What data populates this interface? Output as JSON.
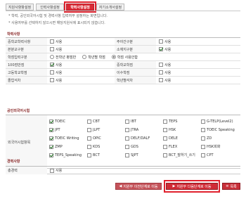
{
  "tabs": [
    {
      "label": "지원사항항설정",
      "active": false
    },
    {
      "label": "인력사항설정",
      "active": false
    },
    {
      "label": "학력사항설정",
      "active": true
    },
    {
      "label": "자기소개서설정",
      "active": false
    }
  ],
  "notices": [
    "* 학력, 공인외국어시험 및 경력사항 입력여부 설정하는 화면입니다.",
    "* 사용여부를 선택하지 않으시면 해당지원서에 표시되지 않습니다."
  ],
  "sections": {
    "education": "학력사항",
    "language": "공인외국어시험",
    "career": "경력사항"
  },
  "common_option": "사용",
  "education_rows": [
    {
      "left_label": "중학교학력사항",
      "left_checked": false,
      "right_label": "주야간구분",
      "right_checked": false
    },
    {
      "left_label": "본분교구분",
      "left_checked": false,
      "right_label": "소재지구분",
      "right_checked": true
    },
    {
      "left_label": "학점입력구분",
      "radios": [
        "전학년 평점만",
        "학년별 학점",
        "학점 사용안함"
      ],
      "radio_selected": 2
    },
    {
      "left_label": "100점만점",
      "left_checked": true,
      "right_label": "중학교학점",
      "right_checked": false
    },
    {
      "left_label": "고등학교학점",
      "left_checked": false,
      "right_label": "이수학점",
      "right_checked": false
    },
    {
      "left_label": "졸업석차",
      "left_checked": false,
      "right_label": "학년별석차",
      "right_checked": false
    }
  ],
  "language_label": "외국어시험항목",
  "language_items": [
    {
      "label": "TOEIC",
      "checked": true
    },
    {
      "label": "CBT",
      "checked": false
    },
    {
      "label": "IBT",
      "checked": false
    },
    {
      "label": "TEPS",
      "checked": false
    },
    {
      "label": "G-TELP(Level2)",
      "checked": false
    },
    {
      "label": "JPT",
      "checked": true
    },
    {
      "label": "JLPT",
      "checked": false
    },
    {
      "label": "JTRA",
      "checked": false
    },
    {
      "label": "HSK",
      "checked": false
    },
    {
      "label": "TOEIC Speaking",
      "checked": false
    },
    {
      "label": "TOEIC Writing",
      "checked": true
    },
    {
      "label": "OPIC",
      "checked": false
    },
    {
      "label": "DELF/DALF",
      "checked": false
    },
    {
      "label": "DELE",
      "checked": false
    },
    {
      "label": "ZD",
      "checked": false
    },
    {
      "label": "ZMP",
      "checked": true
    },
    {
      "label": "KDS",
      "checked": false
    },
    {
      "label": "GDS",
      "checked": false
    },
    {
      "label": "FLEX",
      "checked": false
    },
    {
      "label": "HSK회화",
      "checked": false
    },
    {
      "label": "TEPS_Speaking",
      "checked": true
    },
    {
      "label": "BCT",
      "checked": false
    },
    {
      "label": "SJPT",
      "checked": false
    },
    {
      "label": "BCT_말하기_쓰기",
      "checked": false
    },
    {
      "label": "CPT",
      "checked": false
    }
  ],
  "career_row": {
    "label": "총경력",
    "checked": false
  },
  "buttons": {
    "prev": "지원부 이전단계로 이동",
    "next": "지원부 다음단계로 이동",
    "list": "목록"
  }
}
